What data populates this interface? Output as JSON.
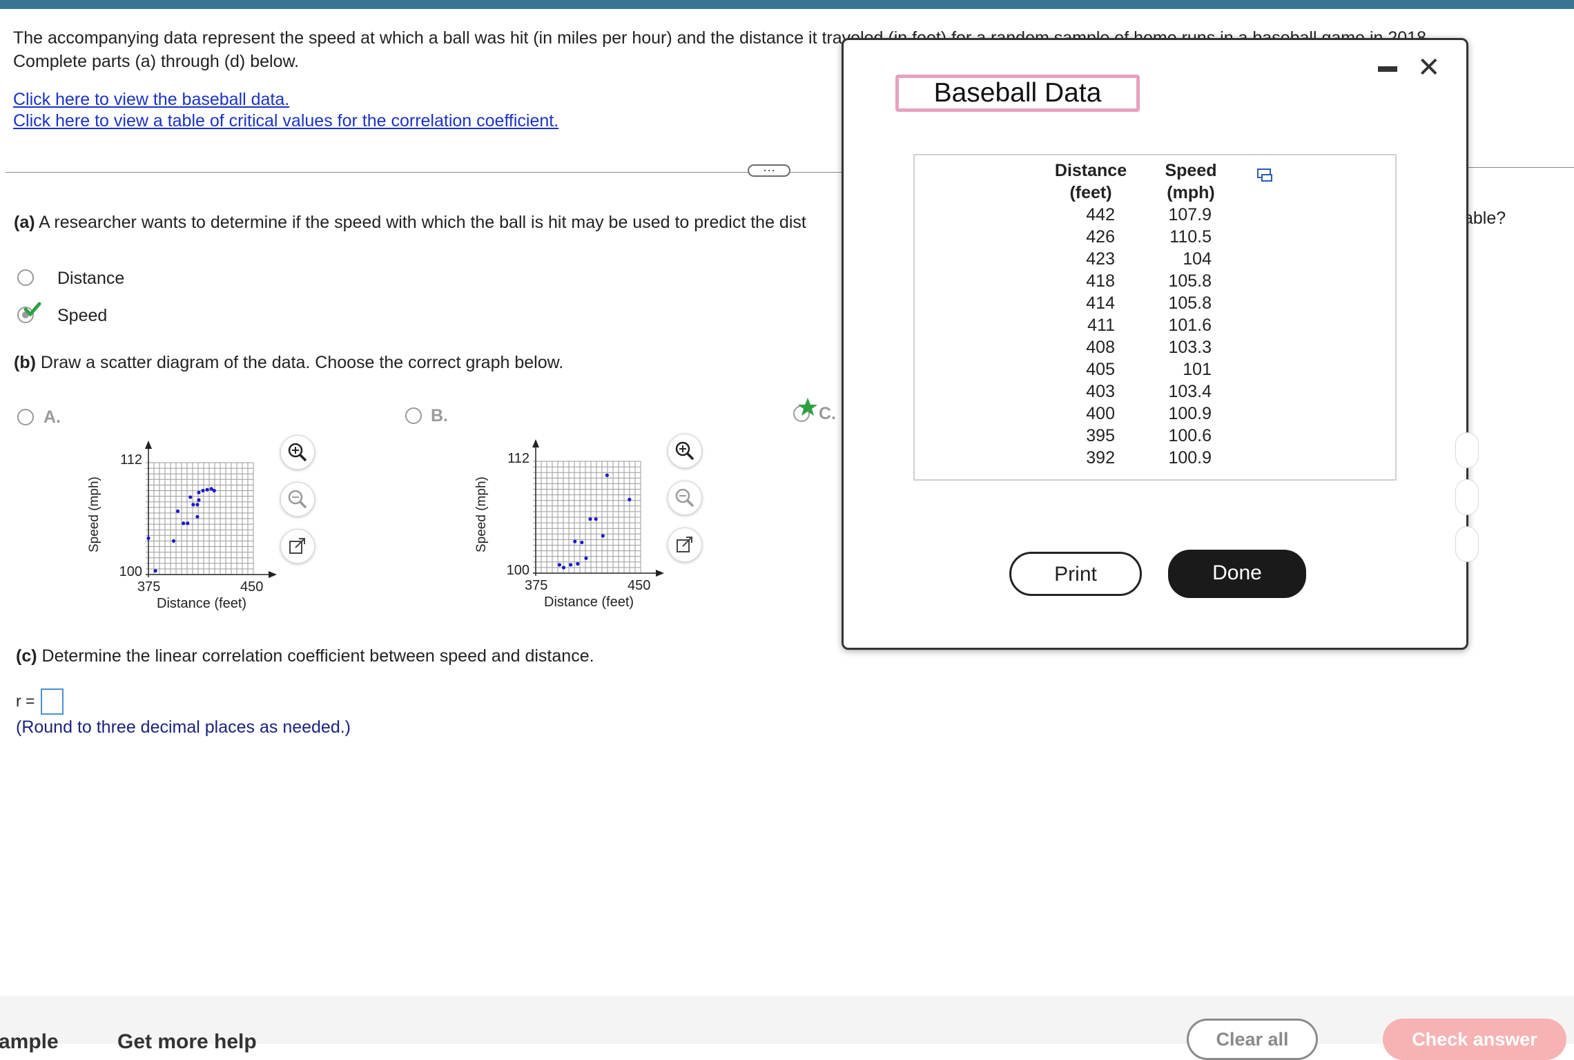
{
  "intro": {
    "line1": "The accompanying data represent the speed at which a ball was hit (in miles per hour) and the distance it traveled (in feet) for a random sample of home runs in a baseball game in 2018.",
    "line2": "Complete parts (a) through (d) below.",
    "link_data": "Click here to view the baseball data.",
    "link_critical": "Click here to view a table of critical values for the correlation coefficient."
  },
  "divider_handle": "···",
  "part_a": {
    "label": "(a)",
    "text": "A researcher wants to determine if the speed with which the ball is hit may be used to predict the dist",
    "text_tail": "able?",
    "options": [
      "Distance",
      "Speed"
    ],
    "selected": "Speed"
  },
  "part_b": {
    "label": "(b)",
    "text": "Draw a scatter diagram of the data. Choose the correct graph below.",
    "options": [
      "A.",
      "B.",
      "C."
    ],
    "selected": "C."
  },
  "graph_a": {
    "ylabel": "Speed (mph)",
    "xlabel": "Distance (feet)",
    "y_top": "112",
    "y_bottom": "100",
    "x_left": "375",
    "x_right": "450"
  },
  "graph_b": {
    "ylabel": "Speed (mph)",
    "xlabel": "Distance (feet)",
    "y_top": "112",
    "y_bottom": "100",
    "x_left": "375",
    "x_right": "450"
  },
  "part_c": {
    "label": "(c)",
    "text": "Determine the linear correlation coefficient between speed and distance.",
    "r_label": "r =",
    "hint": "(Round to three decimal places as needed.)"
  },
  "footer": {
    "left1": "ample",
    "left2": "Get more help",
    "clear_all": "Clear all",
    "check_answer": "Check answer"
  },
  "modal": {
    "title": "Baseball Data",
    "minimize": "—",
    "close": "✕",
    "col_distance": "Distance (feet)",
    "col_distance_l1": "Distance",
    "col_distance_l2": "(feet)",
    "col_speed_l1": "Speed",
    "col_speed_l2": "(mph)",
    "rows": [
      {
        "distance": "442",
        "speed": "107.9"
      },
      {
        "distance": "426",
        "speed": "110.5"
      },
      {
        "distance": "423",
        "speed": "104"
      },
      {
        "distance": "418",
        "speed": "105.8"
      },
      {
        "distance": "414",
        "speed": "105.8"
      },
      {
        "distance": "411",
        "speed": "101.6"
      },
      {
        "distance": "408",
        "speed": "103.3"
      },
      {
        "distance": "405",
        "speed": "101"
      },
      {
        "distance": "403",
        "speed": "103.4"
      },
      {
        "distance": "400",
        "speed": "100.9"
      },
      {
        "distance": "395",
        "speed": "100.6"
      },
      {
        "distance": "392",
        "speed": "100.9"
      }
    ],
    "print_label": "Print",
    "done_label": "Done"
  },
  "colors": {
    "link": "#1a33c4",
    "point": "#1a1acc",
    "accent_pink": "#e7a1c0",
    "check_green": "#2ea043",
    "header_bar": "#3a7493"
  },
  "graph_a_points": [
    {
      "distance": 405,
      "speed": 108.3
    },
    {
      "distance": 411,
      "speed": 108.8
    },
    {
      "distance": 414,
      "speed": 109.0
    },
    {
      "distance": 417,
      "speed": 109.1
    },
    {
      "distance": 420,
      "speed": 109.2
    },
    {
      "distance": 422,
      "speed": 109.0
    },
    {
      "distance": 407,
      "speed": 107.5
    },
    {
      "distance": 410,
      "speed": 107.5
    },
    {
      "distance": 396,
      "speed": 106.8
    },
    {
      "distance": 400,
      "speed": 105.5
    },
    {
      "distance": 403,
      "speed": 105.5
    },
    {
      "distance": 393,
      "speed": 103.6
    },
    {
      "distance": 410,
      "speed": 106.2
    },
    {
      "distance": 411,
      "speed": 108.0
    },
    {
      "distance": 380,
      "speed": 100.4
    },
    {
      "distance": 375,
      "speed": 103.9
    }
  ],
  "graph_b_points": [
    {
      "distance": 392,
      "speed": 100.9
    },
    {
      "distance": 395,
      "speed": 100.6
    },
    {
      "distance": 400,
      "speed": 100.9
    },
    {
      "distance": 403,
      "speed": 103.4
    },
    {
      "distance": 405,
      "speed": 101
    },
    {
      "distance": 408,
      "speed": 103.3
    },
    {
      "distance": 411,
      "speed": 101.6
    },
    {
      "distance": 414,
      "speed": 105.8
    },
    {
      "distance": 418,
      "speed": 105.8
    },
    {
      "distance": 423,
      "speed": 104
    },
    {
      "distance": 426,
      "speed": 110.5
    },
    {
      "distance": 442,
      "speed": 107.9
    }
  ]
}
